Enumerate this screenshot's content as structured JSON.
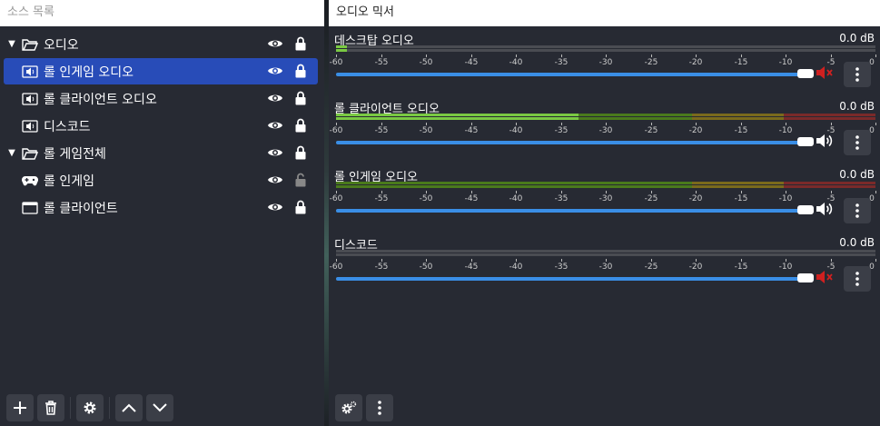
{
  "sources": {
    "title": "소스 목록",
    "items": [
      {
        "label": "오디오",
        "type": "folder",
        "expanded": true
      },
      {
        "label": "롤 인게임 오디오",
        "type": "audio",
        "selected": true
      },
      {
        "label": "롤 클라이언트 오디오",
        "type": "audio"
      },
      {
        "label": "디스코드",
        "type": "audio"
      },
      {
        "label": "롤 게임전체",
        "type": "folder",
        "expanded": true
      },
      {
        "label": "롤 인게임",
        "type": "game",
        "unlocked": true
      },
      {
        "label": "롤 클라이언트",
        "type": "window"
      }
    ],
    "toolbar": [
      "plus-icon",
      "trash-icon",
      "gear-icon",
      "up-arrow-icon",
      "down-arrow-icon"
    ]
  },
  "mixer": {
    "title": "오디오 믹서",
    "scale": [
      "-60",
      "-55",
      "-50",
      "-45",
      "-40",
      "-35",
      "-30",
      "-25",
      "-20",
      "-15",
      "-10",
      "-5",
      "0"
    ],
    "channels": [
      {
        "name": "데스크탑 오디오",
        "db": "0.0 dB",
        "muted": true,
        "level": 0.02,
        "active": false
      },
      {
        "name": "롤 클라이언트 오디오",
        "db": "0.0 dB",
        "muted": false,
        "level": 0.45,
        "active": true
      },
      {
        "name": "롤 인게임 오디오",
        "db": "0.0 dB",
        "muted": false,
        "level": 0.0,
        "active": true
      },
      {
        "name": "디스코드",
        "db": "0.0 dB",
        "muted": true,
        "level": 0.0,
        "active": false
      }
    ],
    "toolbar": [
      "gear-advanced-icon",
      "kebab-icon"
    ]
  },
  "colors": {
    "accent": "#284cb8",
    "slider": "#3a8ee6",
    "mute": "#d02020"
  }
}
